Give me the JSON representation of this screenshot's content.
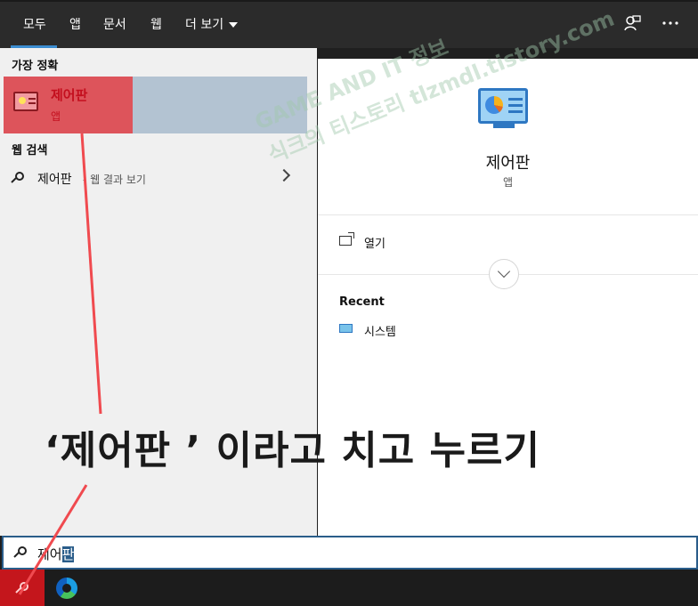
{
  "tabs": [
    {
      "label": "모두",
      "active": true
    },
    {
      "label": "앱"
    },
    {
      "label": "문서"
    },
    {
      "label": "웹"
    },
    {
      "label": "더 보기"
    }
  ],
  "topbar_icons": [
    "feedback-icon",
    "more-options-icon"
  ],
  "left_panel": {
    "best_match_heading": "가장 정확",
    "best_match": {
      "title": "제어판",
      "subtitle": "앱",
      "icon": "control-panel-icon"
    },
    "web_heading": "웹 검색",
    "web_result": {
      "term": "제어판",
      "hint": "- 웹 결과 보기"
    }
  },
  "right_panel": {
    "app_title": "제어판",
    "app_subtitle": "앱",
    "open_label": "열기",
    "recent_heading": "Recent",
    "recent_items": [
      {
        "label": "시스템",
        "icon": "system-icon"
      }
    ]
  },
  "search": {
    "typed_plain": "제어",
    "typed_selected": "판"
  },
  "callout": "‘제어판 ’ 이라고 치고 누르기",
  "watermark": {
    "line1": "GAME AND IT 정보",
    "line2": "식크의 티스토리 tlzmdl.tistory.com"
  },
  "colors": {
    "accent": "#3b8cd0",
    "highlight_red": "#e63c41",
    "selection_blue": "#2a5d8a"
  }
}
